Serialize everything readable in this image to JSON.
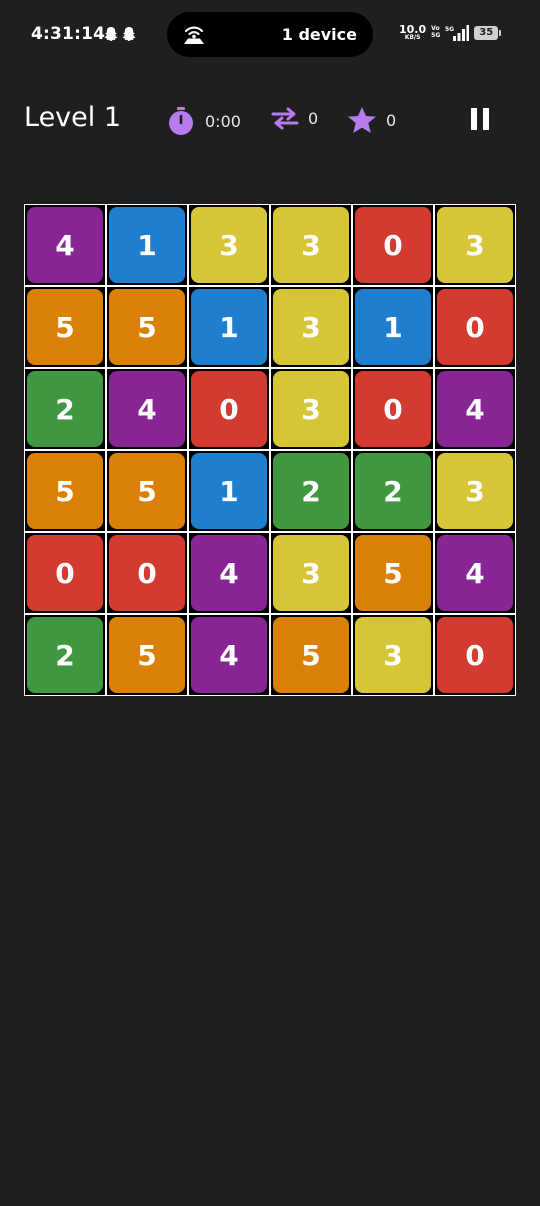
{
  "status_bar": {
    "time": "4:31:14",
    "pill_text": "1 device",
    "net_speed": "10.0",
    "net_unit": "KB/S",
    "volte_top": "Vo",
    "volte_bottom": "5G",
    "network_type": "5G",
    "battery": "35"
  },
  "hud": {
    "level_label": "Level 1",
    "timer": "0:00",
    "moves": "0",
    "stars": "0",
    "accent_color": "#b57bef"
  },
  "board": {
    "rows": 6,
    "cols": 6,
    "colors": {
      "0": "#d13b30",
      "1": "#1f7fce",
      "2": "#3f973f",
      "3": "#d7c538",
      "4": "#872594",
      "5": "#db8006"
    },
    "cells": [
      [
        "4",
        "1",
        "3",
        "3",
        "0",
        "3"
      ],
      [
        "5",
        "5",
        "1",
        "3",
        "1",
        "0"
      ],
      [
        "2",
        "4",
        "0",
        "3",
        "0",
        "4"
      ],
      [
        "5",
        "5",
        "1",
        "2",
        "2",
        "3"
      ],
      [
        "0",
        "0",
        "4",
        "3",
        "5",
        "4"
      ],
      [
        "2",
        "5",
        "4",
        "5",
        "3",
        "0"
      ]
    ]
  }
}
